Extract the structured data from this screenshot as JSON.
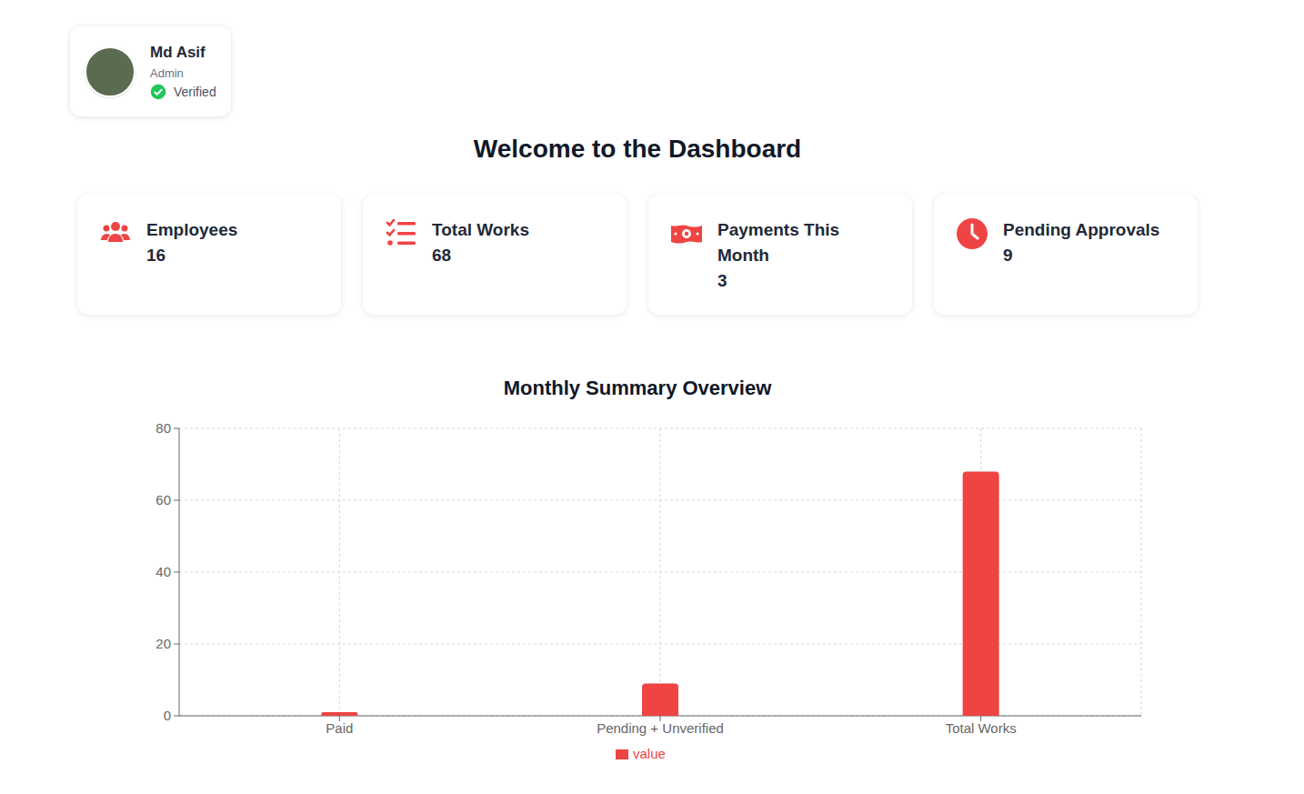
{
  "profile": {
    "name": "Md Asif",
    "role": "Admin",
    "status": "Verified",
    "verified": true
  },
  "heading": "Welcome to the Dashboard",
  "stats": [
    {
      "label": "Employees",
      "value": "16",
      "kind": "employees"
    },
    {
      "label": "Total Works",
      "value": "68",
      "kind": "tasks"
    },
    {
      "label": "Payments This Month",
      "value": "3",
      "kind": "payments"
    },
    {
      "label": "Pending Approvals",
      "value": "9",
      "kind": "pending"
    }
  ],
  "chart": {
    "title": "Monthly Summary Overview",
    "y_ticks": [
      "0",
      "20",
      "40",
      "60",
      "80"
    ],
    "categories": [
      "Paid",
      "Pending + Unverified",
      "Total Works"
    ],
    "series": [
      {
        "name": "value",
        "values": [
          1,
          9,
          68
        ]
      }
    ]
  }
}
